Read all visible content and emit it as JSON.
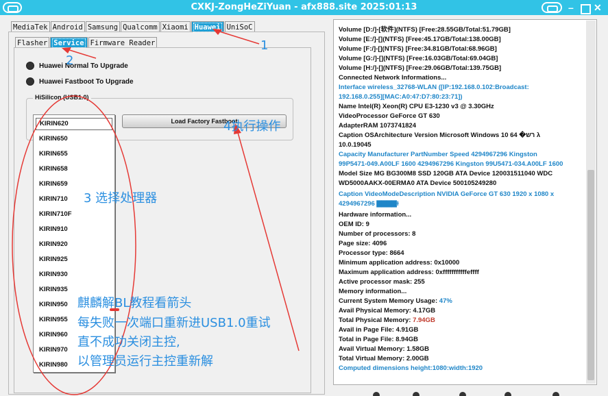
{
  "window": {
    "title": "CXKJ-ZongHeZiYuan - afx888.site 2025:01:13",
    "minimize": "–",
    "close": "✕"
  },
  "vendor_tabs": [
    "MediaTek",
    "Android",
    "Samsung",
    "Qualcomm",
    "Xiaomi",
    "Huawei",
    "UniSoC"
  ],
  "vendor_active": "Huawei",
  "sub_tabs": [
    "Flasher",
    "Service",
    "Firmware Reader"
  ],
  "sub_active": "Service",
  "options": {
    "normal_upgrade": "Huawei Normal To Upgrade",
    "fastboot_upgrade": "Huawei Fastboot To Upgrade"
  },
  "hisilicon": {
    "group_title": "HiSilicon (USB1.0)",
    "load_button": "Load Factory Fastboot",
    "processors": [
      "KIRIN620",
      "KIRIN650",
      "KIRIN655",
      "KIRIN658",
      "KIRIN659",
      "KIRIN710",
      "KIRIN710F",
      "KIRIN910",
      "KIRIN920",
      "KIRIN925",
      "KIRIN930",
      "KIRIN935",
      "KIRIN950",
      "KIRIN955",
      "KIRIN960",
      "KIRIN970",
      "KIRIN980"
    ]
  },
  "log": {
    "volume_d": "Volume [D:/]-[软件](NTFS) [Free:28.55GB/Total:51.79GB]",
    "volume_e": "Volume [E:/]-[](NTFS) [Free:45.17GB/Total:138.00GB]",
    "volume_f": "Volume [F:/]-[](NTFS) [Free:34.81GB/Total:68.96GB]",
    "volume_g": "Volume [G:/]-[](NTFS) [Free:16.03GB/Total:69.04GB]",
    "volume_h": "Volume [H:/]-[](NTFS) [Free:29.06GB/Total:139.75GB]",
    "network_header": "Connected Network Informations...",
    "iface_1": "Interface wireless_32768-WLAN ([IP:192.168.0.102:Broadcast:",
    "iface_2": "192.168.0.255][MAC:A0:47:D7:80:23:71])",
    "cpu": "Name Intel(R) Xeon(R) CPU E3-1230 v3 @ 3.30GHz",
    "gpu": "VideoProcessor GeForce GT 630",
    "adapter_ram": "AdapterRAM 1073741824",
    "os_1": "Caption OSArchitecture Version Microsoft Windows 10 רּש� 64 λ",
    "os_2": "10.0.19045",
    "mem_1": "Capacity Manufacturer PartNumber Speed 4294967296 Kingston",
    "mem_2": "99P5471-049.A00LF 1600 4294967296 Kingston 99U5471-034.A00LF 1600",
    "disk_1": "Model Size MG BG300M8 SSD 120GB ATA Device 120031511040 WDC",
    "disk_2": "WD5000AAKX-00ERMA0 ATA Device 500105249280",
    "video_1": "Caption VideoModeDescription NVIDIA GeForce GT 630 1920 x 1080 x",
    "video_2": "4294967296 ▇▇▇▇ɫ",
    "hw_header": "Hardware information...",
    "oem": "OEM ID: 9",
    "nproc": "Number of processors: 8",
    "page_size": "Page size: 4096",
    "proc_type": "Processor type: 8664",
    "min_addr": "Minimum application address: 0x10000",
    "max_addr": "Maximum application address: 0xfffffffffffeffff",
    "active_mask": "Active processor mask: 255",
    "mem_header": "Memory information...",
    "mem_usage_label": "Current System Memory Usage: ",
    "mem_usage_value": "47%",
    "avail_phys_label": "Avail Physical Memory: ",
    "avail_phys_value": "4.17GB",
    "total_phys_label": "Total Physical Memory: ",
    "total_phys_value": "7.94GB",
    "avail_page_label": "Avail in Page File: ",
    "avail_page_value": "4.91GB",
    "total_page_label": "Total in Page File: ",
    "total_page_value": "8.94GB",
    "avail_virt_label": "Avail Virtual Memory: ",
    "avail_virt_value": "1.58GB",
    "total_virt_label": "Total Virtual Memory: ",
    "total_virt_value": "2.00GB",
    "dimensions": "Computed dimensions height:1080:width:1920"
  },
  "annotations": {
    "step1": "1",
    "step2": "2",
    "step3": "3 选择处理器",
    "step4": "4执行操作",
    "note_1": "麒麟解BL教程看箭头",
    "note_2": "每失败一次端口重新进USB1.0重试",
    "note_3": "直不成功关闭主控,",
    "note_4": "以管理员运行主控重新解",
    "annotation_color": "#2b8fe0",
    "arrow_color": "#e53935"
  }
}
